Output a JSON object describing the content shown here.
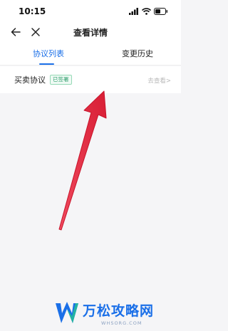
{
  "status_bar": {
    "time": "10:15"
  },
  "nav": {
    "title": "查看详情"
  },
  "tabs": [
    {
      "label": "协议列表",
      "active": true
    },
    {
      "label": "变更历史",
      "active": false
    }
  ],
  "agreements": [
    {
      "name": "买卖协议",
      "status_badge": "已签署",
      "action_label": "去查看>"
    }
  ],
  "watermark": {
    "title": "万松攻略网",
    "subtitle": "WHSORG.COM"
  },
  "colors": {
    "accent": "#1a6fe8",
    "signed_badge": "#2f9e6d",
    "arrow": "#e8253f",
    "link_gray": "#b8b8b8"
  }
}
